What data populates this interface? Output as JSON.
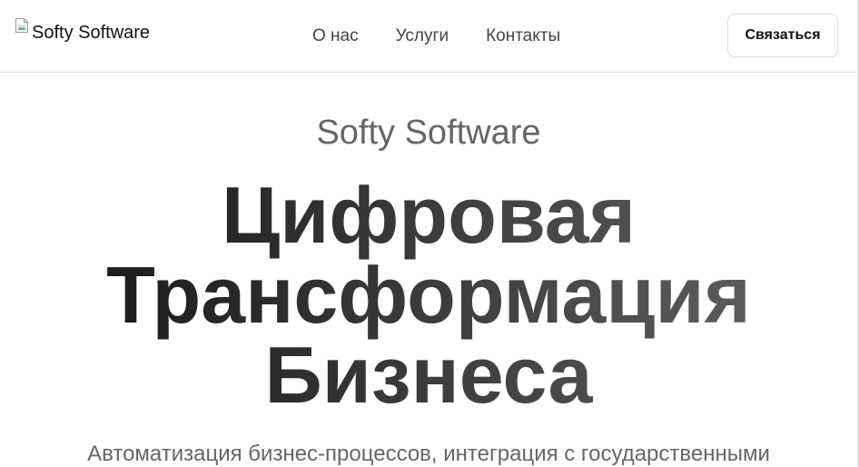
{
  "header": {
    "logo": {
      "alt_text": "Softy Software",
      "icon": "broken-image-icon"
    },
    "nav": [
      {
        "label": "О нас"
      },
      {
        "label": "Услуги"
      },
      {
        "label": "Контакты"
      }
    ],
    "cta_label": "Связаться"
  },
  "hero": {
    "brand": "Softy Software",
    "title": "Цифровая Трансформация Бизнеса",
    "description": "Автоматизация бизнес-процессов, интеграция с государственными"
  },
  "colors": {
    "gradient_start": "#111111",
    "gradient_end": "#666666",
    "muted_text": "#666666",
    "nav_text": "#444444",
    "border": "#e6e6e6"
  }
}
